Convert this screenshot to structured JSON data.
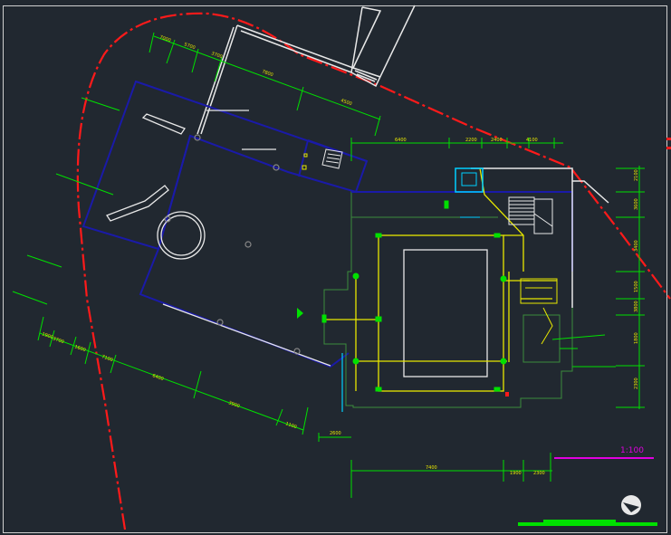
{
  "drawing": {
    "background": "#212830",
    "scale_label": "1:100",
    "colors": {
      "boundary": "#ff1a1a",
      "building": "#1a1aa8",
      "dimension": "#00e000",
      "pipe": "#e8e800",
      "room": "#3c8c3c",
      "white": "#e8e8e8",
      "accent": "#00d0ff",
      "scale": "#e000e0"
    },
    "dims_upper_left": [
      "7000",
      "5700",
      "3700",
      "7800",
      "4500"
    ],
    "dims_top": [
      "6400",
      "2200",
      "2400",
      "4100"
    ],
    "dims_right": [
      "2100",
      "3600",
      "3400",
      "1500",
      "3800",
      "1800",
      "2300"
    ],
    "dims_lower_left": [
      "1900",
      "3700",
      "1600",
      "7100",
      "6400",
      "3900",
      "1100"
    ],
    "dims_bottom": [
      "2600",
      "7400",
      "1900",
      "2300"
    ]
  }
}
